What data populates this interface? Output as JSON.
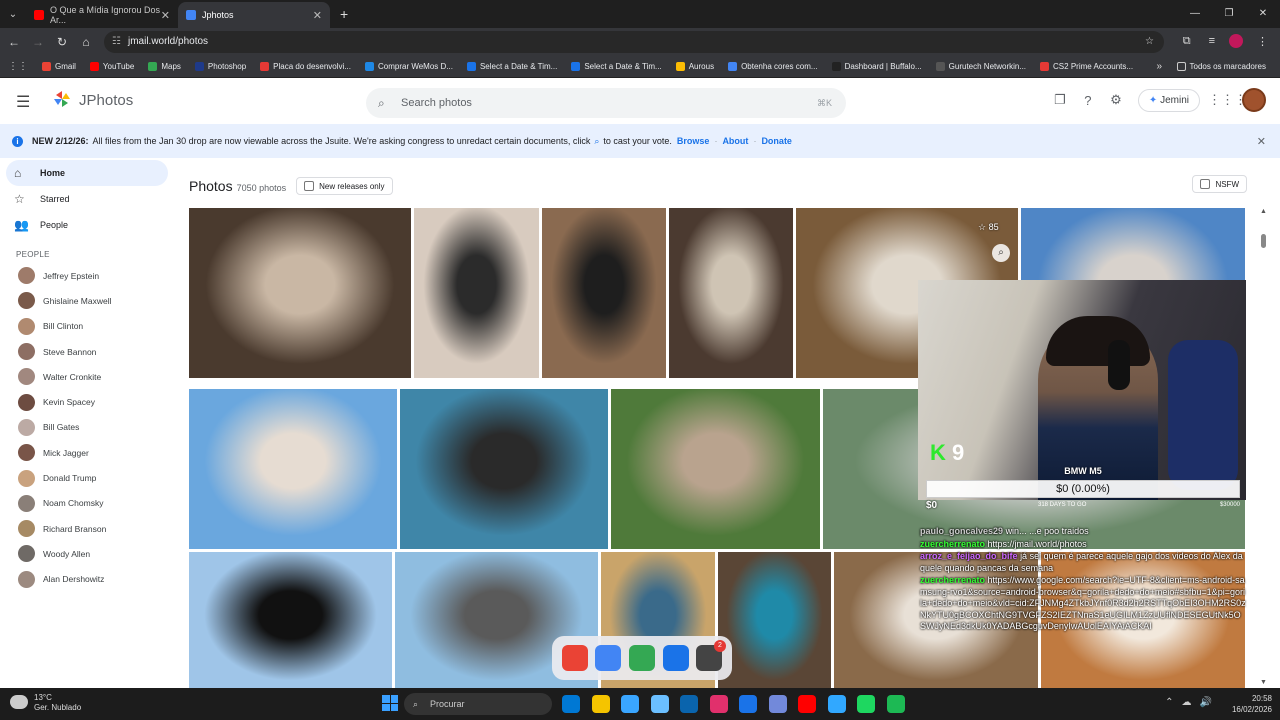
{
  "browser": {
    "tabs": [
      {
        "label": "O Que a Mídia Ignorou Dos Ar...",
        "color": "#ff0000"
      },
      {
        "label": "Jphotos",
        "color": "#4285f4"
      }
    ],
    "new_tab": "+",
    "url": "jmail.world/photos",
    "bookmarks": [
      "Gmail",
      "YouTube",
      "Maps",
      "Photoshop",
      "Placa do desenvolvi...",
      "Comprar WeMos D...",
      "Select a Date & Tim...",
      "Select a Date & Tim...",
      "Aurous",
      "Obtenha cores com...",
      "Dashboard | Buffalo...",
      "Gurutech Networkin...",
      "CS2 Prime Accounts..."
    ],
    "bookmark_colors": [
      "#ea4335",
      "#ff0000",
      "#34a853",
      "#1e3a8a",
      "#e53935",
      "#1e88e5",
      "#1a73e8",
      "#1a73e8",
      "#fbbc04",
      "#4285f4",
      "#222222",
      "#555555",
      "#e53935"
    ],
    "all_bookmarks": "Todos os marcadores",
    "more_bookmarks": "»"
  },
  "app": {
    "title": "JPhotos",
    "search_placeholder": "Search photos",
    "search_shortcut": "⌘K",
    "jemini_label": "Jemini"
  },
  "banner": {
    "bold": "NEW 2/12/26:",
    "text": "All files from the Jan 30 drop are now viewable across the Jsuite. We're asking congress to unredact certain documents, click",
    "text_after": "to cast your vote.",
    "links": [
      "Browse",
      "About",
      "Donate"
    ]
  },
  "sidebar": {
    "items": [
      {
        "label": "Home",
        "icon": "home-icon"
      },
      {
        "label": "Starred",
        "icon": "star-icon"
      },
      {
        "label": "People",
        "icon": "people-icon"
      }
    ],
    "people_header": "PEOPLE",
    "people": [
      "Jeffrey Epstein",
      "Ghislaine Maxwell",
      "Bill Clinton",
      "Steve Bannon",
      "Walter Cronkite",
      "Kevin Spacey",
      "Bill Gates",
      "Mick Jagger",
      "Donald Trump",
      "Noam Chomsky",
      "Richard Branson",
      "Woody Allen",
      "Alan Dershowitz"
    ],
    "people_colors": [
      "#9e7b6a",
      "#7a5a4a",
      "#b08a70",
      "#8d6e63",
      "#a1887f",
      "#6d4c41",
      "#bcaaa4",
      "#795548",
      "#c9a27e",
      "#8a7f78",
      "#a68a64",
      "#6f6a66",
      "#9c8a80"
    ]
  },
  "main": {
    "title": "Photos",
    "count": "7050 photos",
    "new_releases": "New releases only",
    "nsfw": "NSFW",
    "star_count": "85"
  },
  "photos": [
    {
      "color": "#4a3a2e",
      "accent": "#c9b7a4"
    },
    {
      "color": "#d8cbbf",
      "accent": "#2b2b2b"
    },
    {
      "color": "#8a6a50",
      "accent": "#1e1e1e"
    },
    {
      "color": "#4b3a30",
      "accent": "#cfc4b4"
    },
    {
      "color": "#7a5b3a",
      "accent": "#e0d8cc"
    },
    {
      "color": "#4f86c6",
      "accent": "#d8d2cc"
    },
    {
      "color": "#6aa7de",
      "accent": "#e6dcd2"
    },
    {
      "color": "#3f86a8",
      "accent": "#2a2a2a"
    },
    {
      "color": "#4f7a3a",
      "accent": "#b9a38e"
    },
    {
      "color": "#6b8a6a",
      "accent": "#d0d0d0"
    },
    {
      "color": "#9fc5e8",
      "accent": "#111111"
    },
    {
      "color": "#8fbde0",
      "accent": "#5a5a5a"
    },
    {
      "color": "#c9a46a",
      "accent": "#3a6a8a"
    },
    {
      "color": "#5a4636",
      "accent": "#1f8aa8"
    },
    {
      "color": "#8a6a4a",
      "accent": "#e8e0d6"
    },
    {
      "color": "#c07a40",
      "accent": "#f2e8dc"
    }
  ],
  "stream": {
    "k_label": "K",
    "k_value": "9",
    "goal_name": "BMW M5",
    "goal_progress": "$0 (0.00%)",
    "goal_min": "$0",
    "goal_mid": "318 DAYS TO GO",
    "goal_max": "$30000",
    "chat": [
      {
        "user": "paulo_goncalves29",
        "text": "win... ...e poo traidos",
        "color": "#cccccc"
      },
      {
        "user": "zuercherrenato",
        "text": "https://jmail.world/photos",
        "color": "#33ff33"
      },
      {
        "user": "arroz_e_feijao_do_bife",
        "text": "já sei quem é parece aquele gajo dos videos do Alex daquele quando pancas da semana",
        "color": "#cc66ff"
      },
      {
        "user": "zuercherrenato",
        "text": "https://www.google.com/search?ie=UTF-8&client=ms-android-samsung-rvo1&source=android-browser&q=gorila+dedo+do+meio#sbfbu=1&pi=gorila+dedo+do+meio&vld=cid:ZFJNMg4ZTkbJYnf0R3d2h2RSTTqObEI3OHM2RS0zNkYTU0gBCOXChtNG9TVGFZS2IEZTNnaS1eUGILM1ZzUUflNDESEGUtNk5OSWJyNEd3dkUk0YADABGcguvDenyIwAUolEAIYAiACKAI",
        "color": "#33ff33"
      }
    ]
  },
  "dock": [
    "#ea4335",
    "#4285f4",
    "#34a853",
    "#1a73e8",
    "#444444"
  ],
  "dock_badge": "2",
  "taskbar": {
    "temp": "13°C",
    "weather": "Ger. Nublado",
    "search": "Procurar",
    "time": "20:58",
    "date": "16/02/2026",
    "apps": [
      "#0078d4",
      "#f5c400",
      "#3aa6ff",
      "#6bbfff",
      "#0a64ad",
      "#e1306c",
      "#1a73e8",
      "#7289da",
      "#ff0000",
      "#31a8ff",
      "#1ed760",
      "#1db954"
    ]
  }
}
